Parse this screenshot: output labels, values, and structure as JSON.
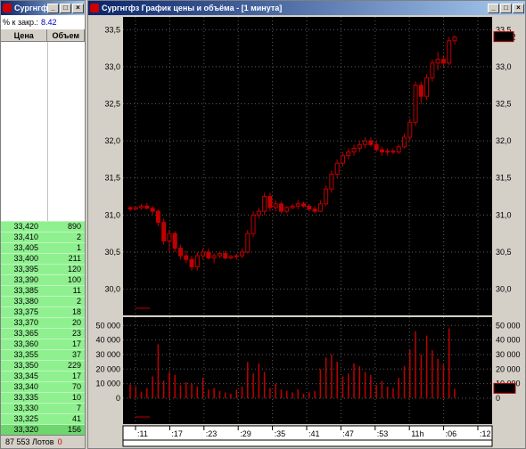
{
  "orderbook_window": {
    "title": "Сургнгфз",
    "close_pct_label": "% к закр.:",
    "close_pct_value": "8.42",
    "columns": [
      "Цена",
      "Объем"
    ],
    "rows": [
      {
        "price": "33,420",
        "volume": "890"
      },
      {
        "price": "33,410",
        "volume": "2"
      },
      {
        "price": "33,405",
        "volume": "1"
      },
      {
        "price": "33,400",
        "volume": "211"
      },
      {
        "price": "33,395",
        "volume": "120"
      },
      {
        "price": "33,390",
        "volume": "100"
      },
      {
        "price": "33,385",
        "volume": "11"
      },
      {
        "price": "33,380",
        "volume": "2"
      },
      {
        "price": "33,375",
        "volume": "18"
      },
      {
        "price": "33,370",
        "volume": "20"
      },
      {
        "price": "33,365",
        "volume": "23"
      },
      {
        "price": "33,360",
        "volume": "17"
      },
      {
        "price": "33,355",
        "volume": "37"
      },
      {
        "price": "33,350",
        "volume": "229"
      },
      {
        "price": "33,345",
        "volume": "17"
      },
      {
        "price": "33,340",
        "volume": "70"
      },
      {
        "price": "33,335",
        "volume": "10"
      },
      {
        "price": "33,330",
        "volume": "7"
      },
      {
        "price": "33,325",
        "volume": "41"
      },
      {
        "price": "33,320",
        "volume": "156"
      }
    ],
    "footer_total": "87 553 Лотов",
    "footer_count": "0"
  },
  "chart_window": {
    "title": "Сургнгфз График цены и объёма - [1 минута]",
    "price_legend": "Сургнгфз [Price]",
    "volume_legend": "Сургнгфз [Volume]",
    "last_price_label": "33,42",
    "last_volume_label": "6 475",
    "price_ticks": [
      "33,5",
      "33,0",
      "32,5",
      "32,0",
      "31,5",
      "31,0",
      "30,5",
      "30,0"
    ],
    "volume_ticks": [
      "50 000",
      "40 000",
      "30 000",
      "20 000",
      "10 000",
      "0"
    ],
    "time_labels": [
      ":11",
      ":17",
      ":23",
      ":29",
      ":35",
      ":41",
      ":47",
      ":53",
      "11h",
      ":06",
      ":12"
    ],
    "colors": {
      "background": "#000000",
      "candle": "#c00000",
      "grid": "#5a5a5a"
    }
  },
  "chart_data": {
    "type": "candlestick",
    "price_ylim": [
      29.85,
      33.6
    ],
    "volume_ylim": [
      0,
      52000
    ],
    "candles": [
      [
        31.1,
        31.12,
        31.05,
        31.08
      ],
      [
        31.08,
        31.12,
        31.06,
        31.1
      ],
      [
        31.1,
        31.15,
        31.07,
        31.12
      ],
      [
        31.12,
        31.16,
        31.08,
        31.09
      ],
      [
        31.09,
        31.12,
        31.0,
        31.05
      ],
      [
        31.05,
        31.08,
        30.85,
        30.9
      ],
      [
        30.9,
        30.95,
        30.6,
        30.65
      ],
      [
        30.65,
        30.8,
        30.5,
        30.75
      ],
      [
        30.75,
        30.78,
        30.5,
        30.55
      ],
      [
        30.55,
        30.6,
        30.4,
        30.45
      ],
      [
        30.45,
        30.52,
        30.35,
        30.4
      ],
      [
        30.4,
        30.45,
        30.25,
        30.3
      ],
      [
        30.3,
        30.5,
        30.25,
        30.45
      ],
      [
        30.45,
        30.55,
        30.4,
        30.5
      ],
      [
        30.5,
        30.55,
        30.4,
        30.42
      ],
      [
        30.42,
        30.48,
        30.35,
        30.45
      ],
      [
        30.45,
        30.5,
        30.42,
        30.48
      ],
      [
        30.48,
        30.52,
        30.4,
        30.42
      ],
      [
        30.42,
        30.46,
        30.4,
        30.44
      ],
      [
        30.44,
        30.48,
        30.4,
        30.45
      ],
      [
        30.45,
        30.55,
        30.42,
        30.5
      ],
      [
        30.5,
        30.8,
        30.48,
        30.75
      ],
      [
        30.75,
        31.05,
        30.7,
        31.0
      ],
      [
        31.0,
        31.1,
        30.95,
        31.05
      ],
      [
        31.05,
        31.3,
        31.0,
        31.25
      ],
      [
        31.25,
        31.3,
        31.05,
        31.1
      ],
      [
        31.1,
        31.2,
        31.05,
        31.15
      ],
      [
        31.15,
        31.18,
        31.02,
        31.05
      ],
      [
        31.05,
        31.12,
        31.02,
        31.1
      ],
      [
        31.1,
        31.15,
        31.08,
        31.12
      ],
      [
        31.12,
        31.2,
        31.08,
        31.15
      ],
      [
        31.15,
        31.18,
        31.1,
        31.12
      ],
      [
        31.12,
        31.15,
        31.05,
        31.08
      ],
      [
        31.08,
        31.12,
        31.02,
        31.05
      ],
      [
        31.05,
        31.2,
        31.04,
        31.15
      ],
      [
        31.15,
        31.4,
        31.12,
        31.35
      ],
      [
        31.35,
        31.6,
        31.3,
        31.55
      ],
      [
        31.55,
        31.75,
        31.5,
        31.7
      ],
      [
        31.7,
        31.85,
        31.65,
        31.8
      ],
      [
        31.8,
        31.9,
        31.75,
        31.85
      ],
      [
        31.85,
        31.95,
        31.8,
        31.9
      ],
      [
        31.9,
        32.0,
        31.85,
        31.95
      ],
      [
        31.95,
        32.05,
        31.9,
        32.0
      ],
      [
        32.0,
        32.05,
        31.92,
        31.95
      ],
      [
        31.95,
        32.0,
        31.85,
        31.88
      ],
      [
        31.88,
        31.92,
        31.8,
        31.85
      ],
      [
        31.85,
        31.9,
        31.8,
        31.86
      ],
      [
        31.86,
        31.9,
        31.82,
        31.85
      ],
      [
        31.85,
        31.95,
        31.82,
        31.92
      ],
      [
        31.92,
        32.1,
        31.9,
        32.05
      ],
      [
        32.05,
        32.3,
        32.0,
        32.25
      ],
      [
        32.25,
        32.8,
        32.2,
        32.75
      ],
      [
        32.75,
        32.8,
        32.5,
        32.6
      ],
      [
        32.6,
        32.9,
        32.55,
        32.85
      ],
      [
        32.85,
        33.1,
        32.8,
        33.05
      ],
      [
        33.05,
        33.2,
        32.95,
        33.1
      ],
      [
        33.1,
        33.15,
        33.0,
        33.05
      ],
      [
        33.05,
        33.4,
        33.02,
        33.35
      ],
      [
        33.35,
        33.42,
        33.3,
        33.4
      ]
    ],
    "volumes": [
      9500,
      8000,
      4500,
      7000,
      15000,
      37000,
      12000,
      18000,
      16000,
      9000,
      11000,
      10000,
      8000,
      14000,
      6000,
      7000,
      5000,
      4000,
      3000,
      6000,
      8000,
      25000,
      17000,
      24000,
      18000,
      7000,
      10000,
      6000,
      5000,
      4000,
      6000,
      3000,
      4000,
      5000,
      20000,
      28000,
      30000,
      25000,
      15000,
      17000,
      24000,
      22000,
      18000,
      16000,
      9000,
      12000,
      8000,
      7000,
      14000,
      22000,
      33000,
      46000,
      30000,
      43000,
      33000,
      27000,
      23000,
      48000,
      6475
    ]
  }
}
